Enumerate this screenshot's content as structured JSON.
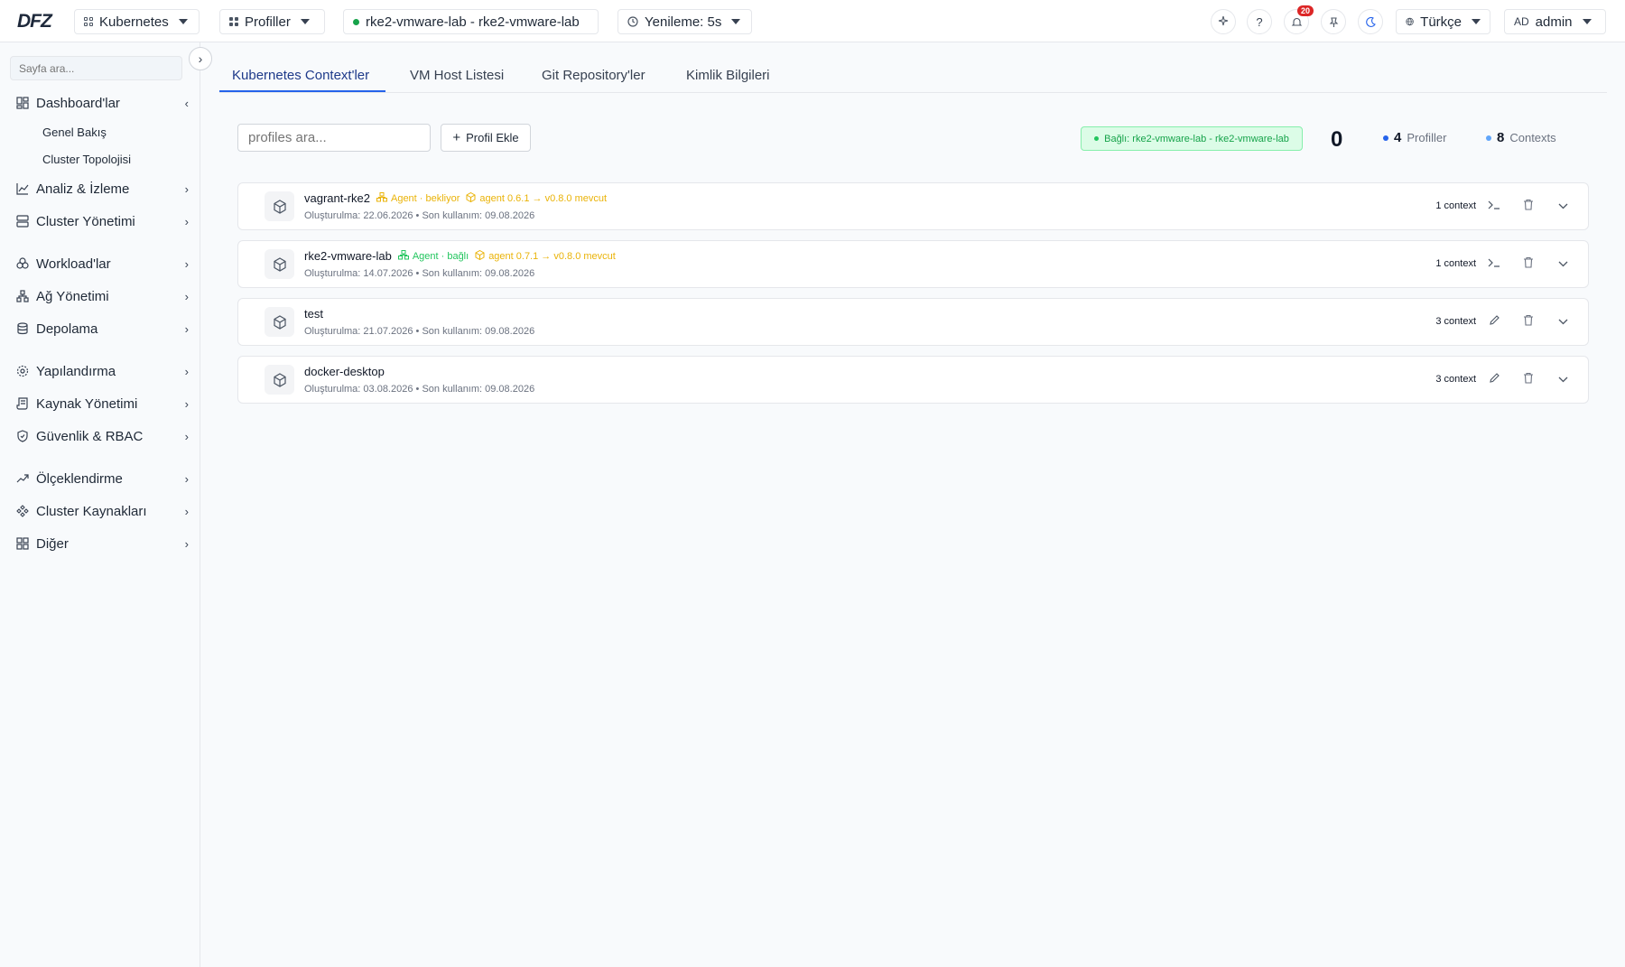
{
  "topbar": {
    "logo": "DFZ",
    "kubernetes_label": "Kubernetes",
    "profiles_label": "Profiller",
    "context_label": "rke2-vmware-lab - rke2-vmware-lab",
    "refresh_label": "Yenileme: 5s",
    "help_label": "?",
    "notification_count": "20",
    "language_label": "Türkçe",
    "user_initials": "AD",
    "user_name": "admin"
  },
  "sidebar": {
    "search_placeholder": "Sayfa ara...",
    "items": [
      {
        "label": "Dashboard'lar",
        "icon": "dashboard-icon"
      },
      {
        "label": "Analiz & İzleme",
        "icon": "chart-line-icon"
      },
      {
        "label": "Cluster Yönetimi",
        "icon": "server-icon"
      },
      {
        "label": "Workload'lar",
        "icon": "workloads-icon"
      },
      {
        "label": "Ağ Yönetimi",
        "icon": "network-icon"
      },
      {
        "label": "Depolama",
        "icon": "database-icon"
      },
      {
        "label": "Yapılandırma",
        "icon": "gear-icon"
      },
      {
        "label": "Kaynak Yönetimi",
        "icon": "scroll-icon"
      },
      {
        "label": "Güvenlik & RBAC",
        "icon": "shield-icon"
      },
      {
        "label": "Ölçeklendirme",
        "icon": "trending-up-icon"
      },
      {
        "label": "Cluster Kaynakları",
        "icon": "components-icon"
      },
      {
        "label": "Diğer",
        "icon": "grid-icon"
      }
    ],
    "sub_items": [
      "Genel Bakış",
      "Cluster Topolojisi"
    ]
  },
  "tabs": [
    "Kubernetes Context'ler",
    "VM Host Listesi",
    "Git Repository'ler",
    "Kimlik Bilgileri"
  ],
  "toolbar": {
    "search_placeholder": "profiles ara...",
    "add_button": "Profil Ekle",
    "connected_badge": "Bağlı: rke2-vmware-lab - rke2-vmware-lab",
    "stat_zero": "0",
    "profiles_count": "4",
    "profiles_label": "Profiller",
    "contexts_count": "8",
    "contexts_label": "Contexts"
  },
  "colors": {
    "accent": "#2563eb",
    "success": "#16a34a",
    "warning": "#eab308",
    "danger": "#dc2626"
  },
  "profiles": [
    {
      "name": "vagrant-rke2",
      "agent_status": "Agent · bekliyor",
      "agent_status_kind": "warn",
      "agent_version": "agent 0.6.1 → v0.8.0 mevcut",
      "created": "Oluşturulma: 22.06.2026",
      "last_used": "Son kullanım: 09.08.2026",
      "context_count": "1 context",
      "action_icon": "terminal-icon"
    },
    {
      "name": "rke2-vmware-lab",
      "agent_status": "Agent · bağlı",
      "agent_status_kind": "ok",
      "agent_version": "agent 0.7.1 → v0.8.0 mevcut",
      "created": "Oluşturulma: 14.07.2026",
      "last_used": "Son kullanım: 09.08.2026",
      "context_count": "1 context",
      "action_icon": "terminal-icon"
    },
    {
      "name": "test",
      "agent_status": "",
      "agent_status_kind": "",
      "agent_version": "",
      "created": "Oluşturulma: 21.07.2026",
      "last_used": "Son kullanım: 09.08.2026",
      "context_count": "3 context",
      "action_icon": "pencil-icon"
    },
    {
      "name": "docker-desktop",
      "agent_status": "",
      "agent_status_kind": "",
      "agent_version": "",
      "created": "Oluşturulma: 03.08.2026",
      "last_used": "Son kullanım: 09.08.2026",
      "context_count": "3 context",
      "action_icon": "pencil-icon"
    }
  ]
}
